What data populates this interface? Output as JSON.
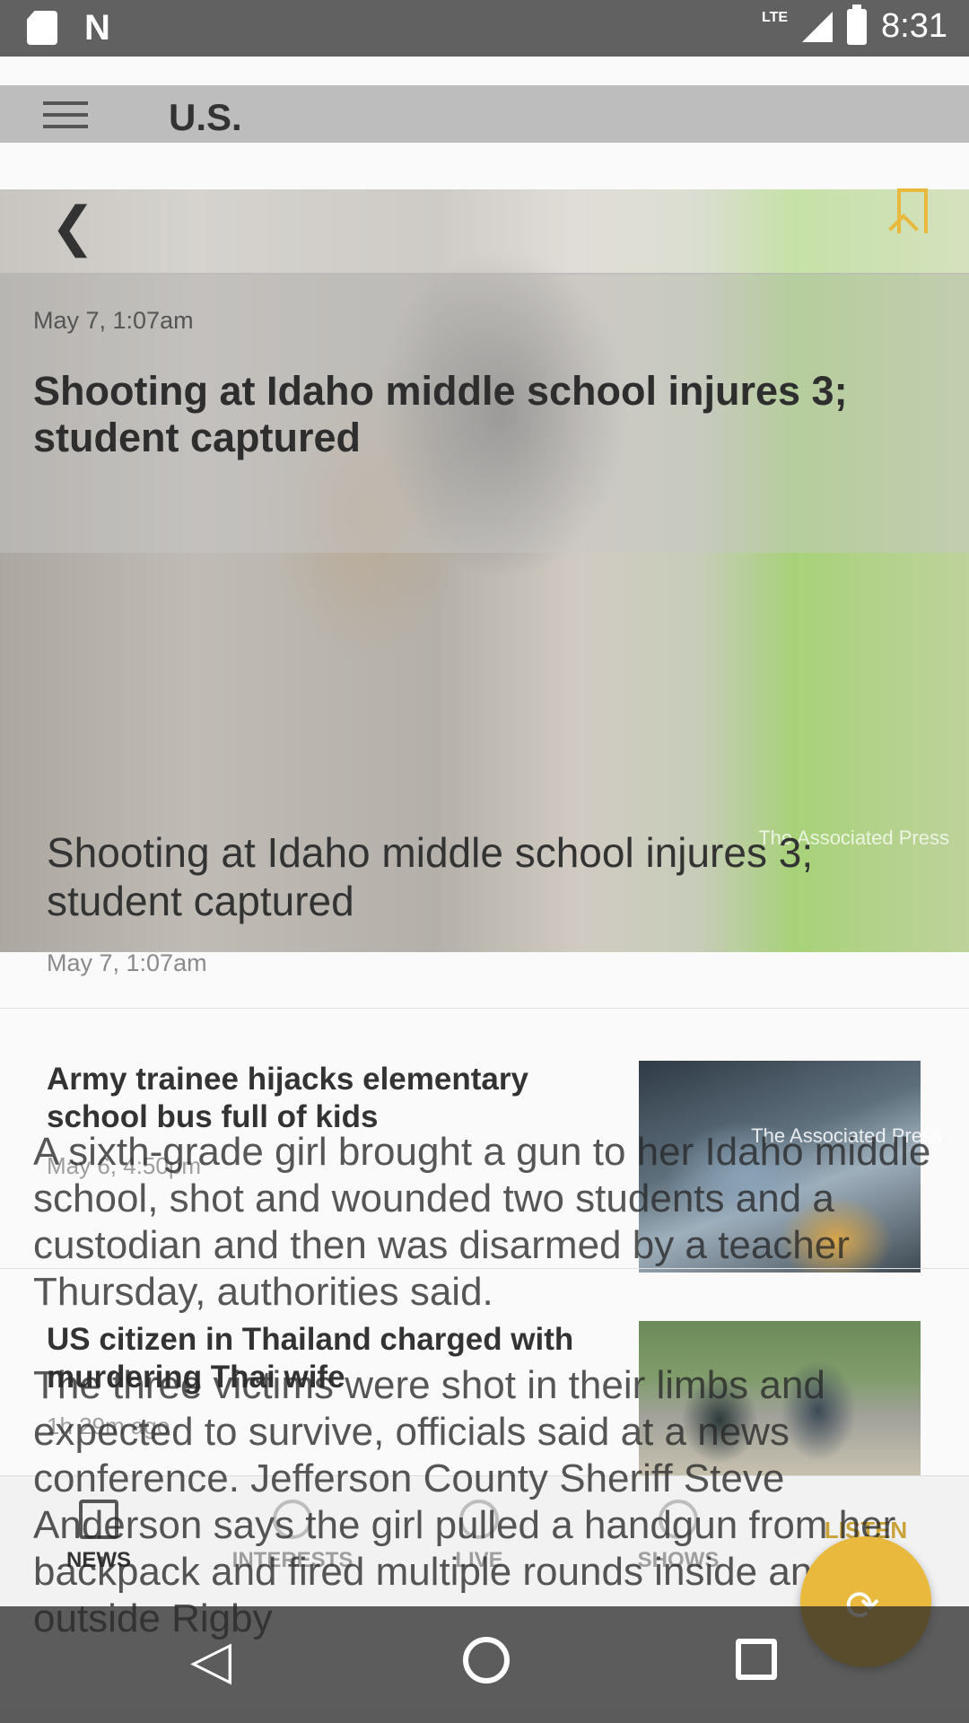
{
  "status_bar": {
    "network": "LTE",
    "time": "8:31"
  },
  "app_bar": {
    "title": "U.S."
  },
  "hero": {
    "credit": "The Associated Press"
  },
  "feature": {
    "title": "Shooting at Idaho middle school injures 3; student captured",
    "date": "May 7, 1:07am"
  },
  "list": [
    {
      "title": "Army trainee hijacks elementary school bus full of kids",
      "date": "May 6, 4:50pm",
      "credit": "The Associated Press"
    },
    {
      "title": "US citizen in Thailand charged with murdering Thai wife",
      "date": "1h 29m ago"
    }
  ],
  "bottom_nav": {
    "items": [
      {
        "label": "NEWS"
      },
      {
        "label": "INTERESTS"
      },
      {
        "label": "LIVE"
      },
      {
        "label": "SHOWS"
      }
    ],
    "listen_label": "LISTEN"
  },
  "article": {
    "date": "May 7, 1:07am",
    "title": "Shooting at Idaho middle school injures 3; student captured",
    "paragraphs": [
      "A sixth-grade girl brought a gun to her Idaho middle school, shot and wounded two students and a custodian and then was disarmed by a teacher Thursday, authorities said.",
      "The three victims were shot in their limbs and expected to survive, officials said at a news conference. Jefferson County Sheriff Steve Anderson says the girl pulled a handgun from her backpack and fired multiple rounds inside and outside Rigby"
    ]
  },
  "colors": {
    "accent": "#e8b93c",
    "status_bar": "#616161"
  },
  "icons": [
    "sd-card-icon",
    "n-notification-icon",
    "signal-icon",
    "battery-icon",
    "menu-icon",
    "back-icon",
    "bookmark-icon",
    "share-icon"
  ]
}
